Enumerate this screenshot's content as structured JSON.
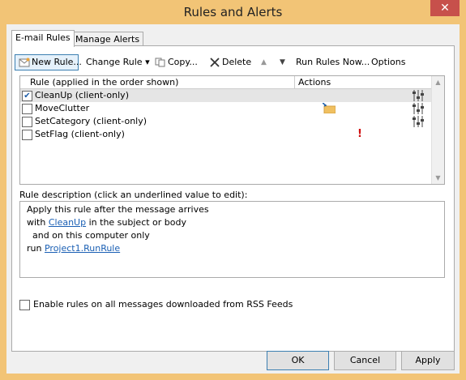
{
  "window": {
    "title": "Rules and Alerts",
    "close_glyph": "✕"
  },
  "tabs": [
    {
      "label": "E-mail Rules",
      "active": true
    },
    {
      "label": "Manage Alerts",
      "active": false
    }
  ],
  "toolbar": {
    "new_rule": {
      "label": "New Rule...",
      "icon": "new-rule-icon"
    },
    "change_rule": {
      "label": "Change Rule",
      "arrow": "▾"
    },
    "copy": {
      "label": "Copy...",
      "icon": "copy-icon"
    },
    "delete": {
      "label": "Delete",
      "icon": "delete-x-icon"
    },
    "move_up": "▲",
    "move_down": "▼",
    "run_rules_now": "Run Rules Now...",
    "options": "Options"
  },
  "grid": {
    "col_rule": "Rule (applied in the order shown)",
    "col_actions": "Actions",
    "scroll_up": "▲",
    "scroll_down": "▼",
    "rows": [
      {
        "name": "CleanUp  (client-only)",
        "checked": true,
        "check": "✔",
        "selected": true,
        "actions": [
          "sliders-icon"
        ]
      },
      {
        "name": "MoveClutter",
        "checked": false,
        "selected": false,
        "actions": [
          "move-to-folder-icon",
          "sliders-icon"
        ]
      },
      {
        "name": "SetCategory  (client-only)",
        "checked": false,
        "selected": false,
        "actions": [
          "sliders-icon"
        ]
      },
      {
        "name": "SetFlag  (client-only)",
        "checked": false,
        "selected": false,
        "actions": [
          "importance-icon"
        ],
        "importance": "!"
      }
    ]
  },
  "description": {
    "label": "Rule description (click an underlined value to edit):",
    "line1": "Apply this rule after the message arrives",
    "line2_pre": "with ",
    "line2_link": "CleanUp",
    "line2_post": " in the subject or body",
    "line3": "  and on this computer only",
    "line4_pre": "run ",
    "line4_link": "Project1.RunRule"
  },
  "rss": {
    "label": "Enable rules on all messages downloaded from RSS Feeds",
    "checked": false
  },
  "buttons": {
    "ok": "OK",
    "cancel": "Cancel",
    "apply": "Apply"
  },
  "colors": {
    "frame": "#f2c476",
    "close": "#c7504b",
    "link": "#1a5fb4",
    "selected_row": "#e5e5e5",
    "importance": "#d01010"
  }
}
